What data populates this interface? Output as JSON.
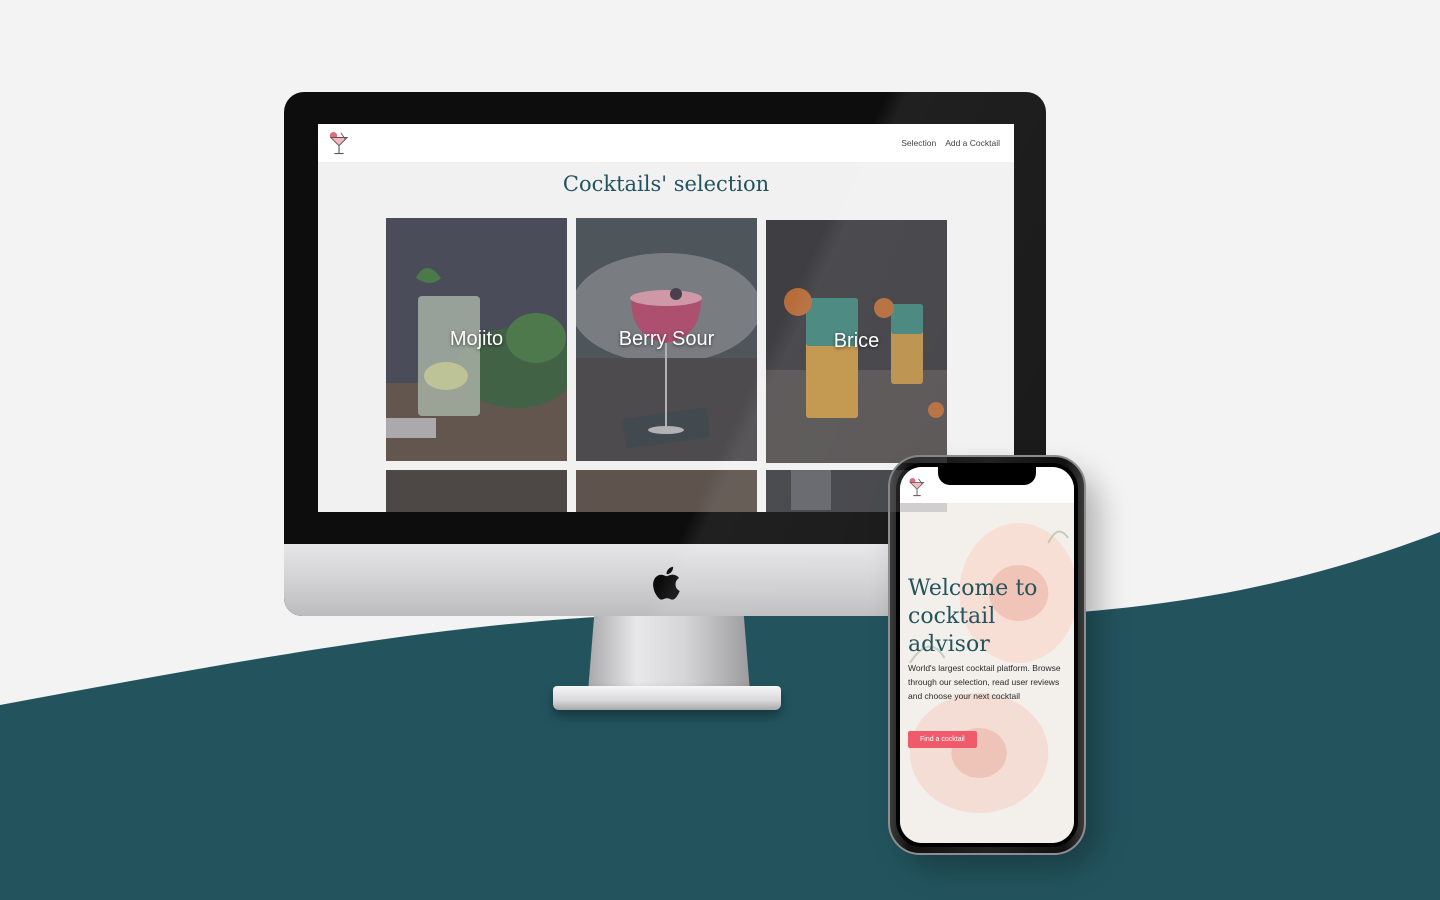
{
  "colors": {
    "background": "#f3f3f3",
    "teal": "#23545e",
    "accent_button": "#ef5b6b",
    "nav_background": "#ffffff"
  },
  "desktop_site": {
    "logo_icon": "cocktail-glass-icon",
    "nav": {
      "selection_label": "Selection",
      "add_cocktail_label": "Add a Cocktail"
    },
    "page_title": "Cocktails' selection",
    "cards": [
      {
        "name": "Mojito"
      },
      {
        "name": "Berry Sour"
      },
      {
        "name": "Brice"
      }
    ]
  },
  "mobile_site": {
    "logo_icon": "cocktail-glass-icon",
    "hero": {
      "title": "Welcome to cocktail advisor",
      "text": "World's largest cocktail platform. Browse through our selection, read user reviews and choose your next cocktail",
      "button_label": "Find a cocktail"
    }
  },
  "devices": {
    "desktop_logo_icon": "apple-icon"
  }
}
